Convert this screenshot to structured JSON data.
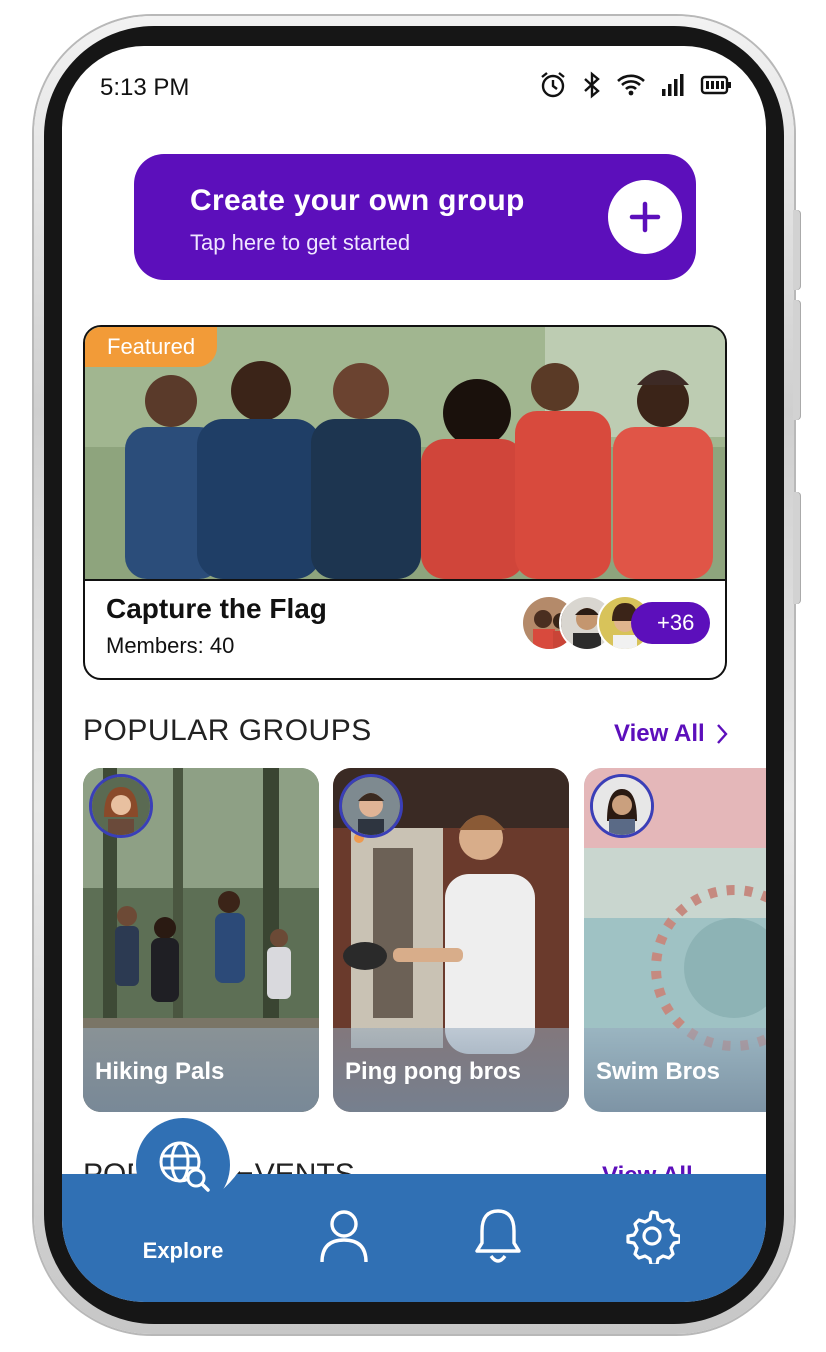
{
  "status_bar": {
    "time": "5:13 PM"
  },
  "create_group": {
    "title": "Create your own group",
    "subtitle": "Tap here to get started"
  },
  "featured": {
    "badge": "Featured",
    "title": "Capture the Flag",
    "members": "Members: 40",
    "extra_count": "+36"
  },
  "popular_groups": {
    "title": "POPULAR GROUPS",
    "view_all": "View All",
    "items": [
      {
        "name": "Hiking Pals"
      },
      {
        "name": "Ping pong bros"
      },
      {
        "name": "Swim Bros"
      }
    ]
  },
  "events": {
    "title": "POPULAR EVENTS",
    "view_all": "View All"
  },
  "nav": {
    "explore": "Explore"
  },
  "colors": {
    "primary": "#5c0fbb",
    "nav": "#3070b4",
    "badge": "#f29b38"
  },
  "icons": [
    "alarm-icon",
    "bluetooth-icon",
    "wifi-icon",
    "signal-icon",
    "battery-icon",
    "plus-icon",
    "chevron-right-icon",
    "globe-search-icon",
    "user-icon",
    "bell-icon",
    "gear-icon"
  ]
}
